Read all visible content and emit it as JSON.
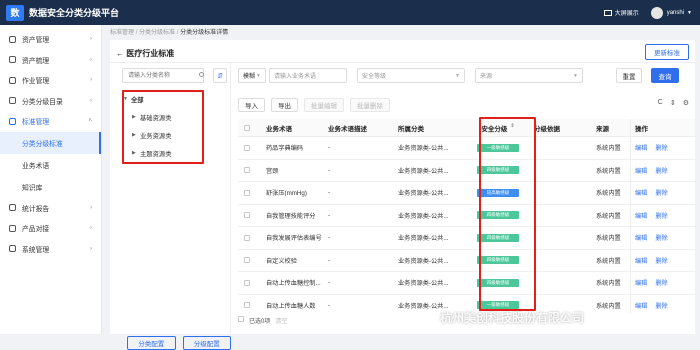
{
  "app": {
    "logo": "数",
    "title": "数据安全分类分级平台",
    "big_screen": "大屏展示",
    "username": "yanshi"
  },
  "sidebar": {
    "items": [
      {
        "label": "资产管理",
        "icon": "box-icon"
      },
      {
        "label": "资产梳理",
        "icon": "list-icon"
      },
      {
        "label": "作业管理",
        "icon": "task-icon"
      },
      {
        "label": "分类分级目录",
        "icon": "folder-icon"
      },
      {
        "label": "标准管理",
        "icon": "standard-icon"
      }
    ],
    "sub_items": [
      "分类分级标准",
      "业务术语",
      "知识库"
    ],
    "items_after": [
      {
        "label": "统计报告",
        "icon": "chart-icon"
      },
      {
        "label": "产品对接",
        "icon": "link-icon"
      },
      {
        "label": "系统管理",
        "icon": "settings-icon"
      }
    ]
  },
  "breadcrumb": {
    "part1": "标准管理",
    "sep": "/",
    "part2": "分类分级标准",
    "part3": "分类分级标准详情"
  },
  "page": {
    "title": "← 医疗行业标准",
    "update_button": "更新标准"
  },
  "tree": {
    "search_placeholder": "请输入分类名称",
    "action_icon": "⇵",
    "root": "全部",
    "children": [
      "基础资源类",
      "业务资源类",
      "主题资源类"
    ],
    "btn_classify": "分类配置",
    "btn_grade": "分级配置"
  },
  "filters": {
    "match_mode": "模糊",
    "term_placeholder": "请输入业务术语",
    "level_placeholder": "安全等级",
    "source_placeholder": "来源",
    "reset": "重置",
    "query": "查询"
  },
  "toolbar": {
    "import": "导入",
    "export": "导出",
    "batch_edit": "批量编辑",
    "batch_delete": "批量删除"
  },
  "table": {
    "headers": {
      "term": "业务术语",
      "desc": "业务术语描述",
      "class": "所属分类",
      "level": "安全分级",
      "basis": "分级依据",
      "source": "来源",
      "ops": "操作"
    },
    "rows": [
      {
        "term": "药品字典编码",
        "desc": "-",
        "class": "业务资源类-公共...",
        "level": "一级敏感级",
        "basis": "-",
        "source": "系统内置",
        "edit": "编辑",
        "delete": "删除"
      },
      {
        "term": "宫颈",
        "desc": "-",
        "class": "业务资源类-公共...",
        "level": "四级敏感级",
        "basis": "-",
        "source": "系统内置",
        "edit": "编辑",
        "delete": "删除"
      },
      {
        "term": "舒张压(mmHg)",
        "desc": "-",
        "class": "业务资源类-公共...",
        "level": "较高敏感级",
        "basis": "-",
        "source": "系统内置",
        "edit": "编辑",
        "delete": "删除"
      },
      {
        "term": "自我管理技能评分",
        "desc": "-",
        "class": "业务资源类-公共...",
        "level": "四级敏感级",
        "basis": "-",
        "source": "系统内置",
        "edit": "编辑",
        "delete": "删除"
      },
      {
        "term": "自我发展评估表编号",
        "desc": "-",
        "class": "业务资源类-公共...",
        "level": "四级敏感级",
        "basis": "-",
        "source": "系统内置",
        "edit": "编辑",
        "delete": "删除"
      },
      {
        "term": "自定义校验",
        "desc": "-",
        "class": "业务资源类-公共...",
        "level": "四级敏感级",
        "basis": "-",
        "source": "系统内置",
        "edit": "编辑",
        "delete": "删除"
      },
      {
        "term": "自动上传血糖控制...",
        "desc": "-",
        "class": "业务资源类-公共...",
        "level": "四级敏感级",
        "basis": "-",
        "source": "系统内置",
        "edit": "编辑",
        "delete": "删除"
      },
      {
        "term": "自动上传血糖人数",
        "desc": "-",
        "class": "业务资源类-公共...",
        "level": "一级敏感级",
        "basis": "-",
        "source": "系统内置",
        "edit": "编辑",
        "delete": "删除"
      }
    ]
  },
  "footer": {
    "selected": "已选0项",
    "clear": "清空"
  },
  "watermark": "杭州美创科技股份有限公司",
  "colors": {
    "primary": "#2f6fed",
    "topbar": "#1b2e4b",
    "highlight": "#e0201b",
    "badge_green": "#4cc79a",
    "badge_blue": "#3d8ef0"
  }
}
